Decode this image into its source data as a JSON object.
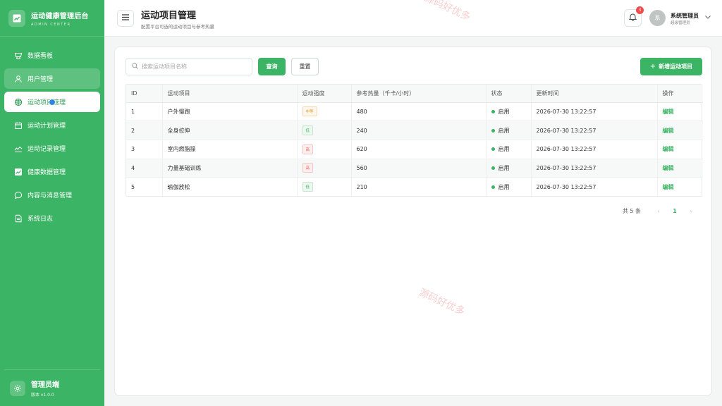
{
  "brand": {
    "title": "运动健康管理后台",
    "subtitle": "ADMIN CENTER"
  },
  "sidebar": {
    "items": [
      {
        "label": "数据看板",
        "icon": "dashboard-icon"
      },
      {
        "label": "用户管理",
        "icon": "user-icon"
      },
      {
        "label": "运动项目管理",
        "icon": "sport-ball-icon"
      },
      {
        "label": "运动计划管理",
        "icon": "calendar-icon"
      },
      {
        "label": "运动记录管理",
        "icon": "activity-icon"
      },
      {
        "label": "健康数据管理",
        "icon": "chart-icon"
      },
      {
        "label": "内容与消息管理",
        "icon": "message-icon"
      },
      {
        "label": "系统日志",
        "icon": "document-icon"
      }
    ],
    "active_index": 2,
    "footer": {
      "title": "管理员端",
      "version": "版本 v1.0.0"
    }
  },
  "header": {
    "title": "运动项目管理",
    "subtitle": "配置平台可选的运动项目与参考热量",
    "notification_count": "3",
    "avatar_text": "系",
    "user_name": "系统管理员",
    "user_role": "超级管理员"
  },
  "toolbar": {
    "search_placeholder": "搜索运动项目名称",
    "search_value": "",
    "query_label": "查询",
    "reset_label": "重置",
    "add_label": "新增运动项目"
  },
  "table": {
    "columns": [
      "ID",
      "运动项目",
      "运动强度",
      "参考热量（千卡/小时）",
      "状态",
      "更新时间",
      "操作"
    ],
    "rows": [
      {
        "id": "1",
        "name": "户外慢跑",
        "intensity": "中等",
        "intensity_level": "mid",
        "calories": "480",
        "status": "启用",
        "updated": "2026-07-30 13:22:57",
        "action": "编辑"
      },
      {
        "id": "2",
        "name": "全身拉伸",
        "intensity": "低",
        "intensity_level": "low",
        "calories": "240",
        "status": "启用",
        "updated": "2026-07-30 13:22:57",
        "action": "编辑"
      },
      {
        "id": "3",
        "name": "室内燃脂操",
        "intensity": "高",
        "intensity_level": "high",
        "calories": "620",
        "status": "启用",
        "updated": "2026-07-30 13:22:57",
        "action": "编辑"
      },
      {
        "id": "4",
        "name": "力量基础训练",
        "intensity": "高",
        "intensity_level": "high",
        "calories": "560",
        "status": "启用",
        "updated": "2026-07-30 13:22:57",
        "action": "编辑"
      },
      {
        "id": "5",
        "name": "瑜伽放松",
        "intensity": "低",
        "intensity_level": "low",
        "calories": "210",
        "status": "启用",
        "updated": "2026-07-30 13:22:57",
        "action": "编辑"
      }
    ]
  },
  "pagination": {
    "total": "共 5 条",
    "current_page": "1",
    "prev": "‹",
    "next": "›"
  },
  "watermark": "源码好优多",
  "colors": {
    "primary": "#3cb465",
    "danger": "#f04b4b",
    "warning": "#e6a23c"
  }
}
